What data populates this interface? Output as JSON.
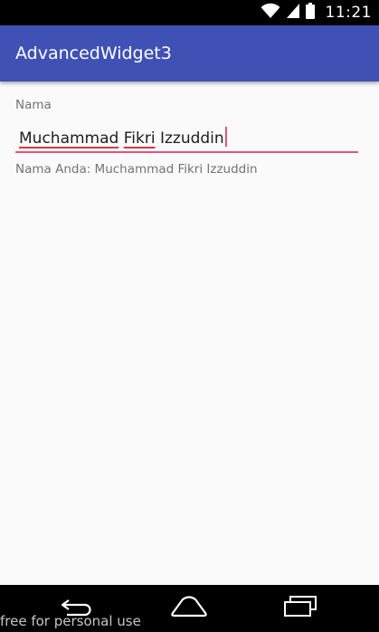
{
  "status_bar": {
    "time": "11:21",
    "icons": [
      "wifi-icon",
      "signal-icon",
      "battery-icon"
    ]
  },
  "app_bar": {
    "title": "AdvancedWidget3",
    "color": "#3f51b5"
  },
  "form": {
    "label": "Nama",
    "input_words": [
      "Muchammad",
      "Fikri",
      "Izzuddin"
    ],
    "underline_color": "#e05282",
    "output": "Nama Anda: Muchammad Fikri Izzuddin"
  },
  "nav_bar": {
    "icons": [
      "back-icon",
      "home-icon",
      "recents-icon"
    ]
  },
  "watermark": "free for personal use"
}
